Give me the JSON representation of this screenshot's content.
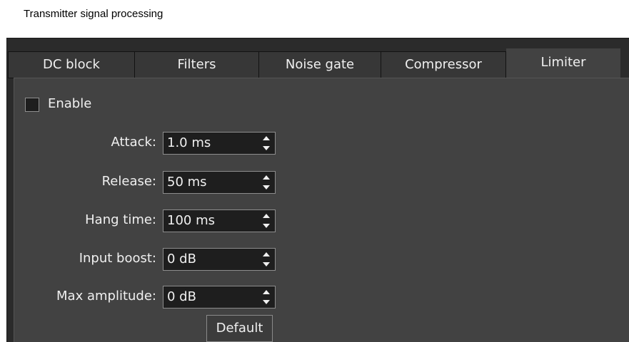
{
  "window": {
    "title": "Transmitter signal processing"
  },
  "tabs": [
    {
      "label": "DC block",
      "active": false
    },
    {
      "label": "Filters",
      "active": false
    },
    {
      "label": "Noise gate",
      "active": false
    },
    {
      "label": "Compressor",
      "active": false
    },
    {
      "label": "Limiter",
      "active": true
    }
  ],
  "limiter": {
    "enable": {
      "label": "Enable",
      "checked": false
    },
    "fields": [
      {
        "label": "Attack:",
        "value": "1.0 ms"
      },
      {
        "label": "Release:",
        "value": "50 ms"
      },
      {
        "label": "Hang time:",
        "value": "100 ms"
      },
      {
        "label": "Input boost:",
        "value": "0 dB"
      },
      {
        "label": "Max amplitude:",
        "value": "0 dB"
      }
    ],
    "default_button": "Default"
  },
  "colors": {
    "panel_bg": "#2b2b2b",
    "page_bg": "#424242",
    "input_bg": "#1e1e1e",
    "text": "#f0f0f0"
  },
  "icons": {
    "spin_arrows": "up-down-arrows-icon"
  }
}
